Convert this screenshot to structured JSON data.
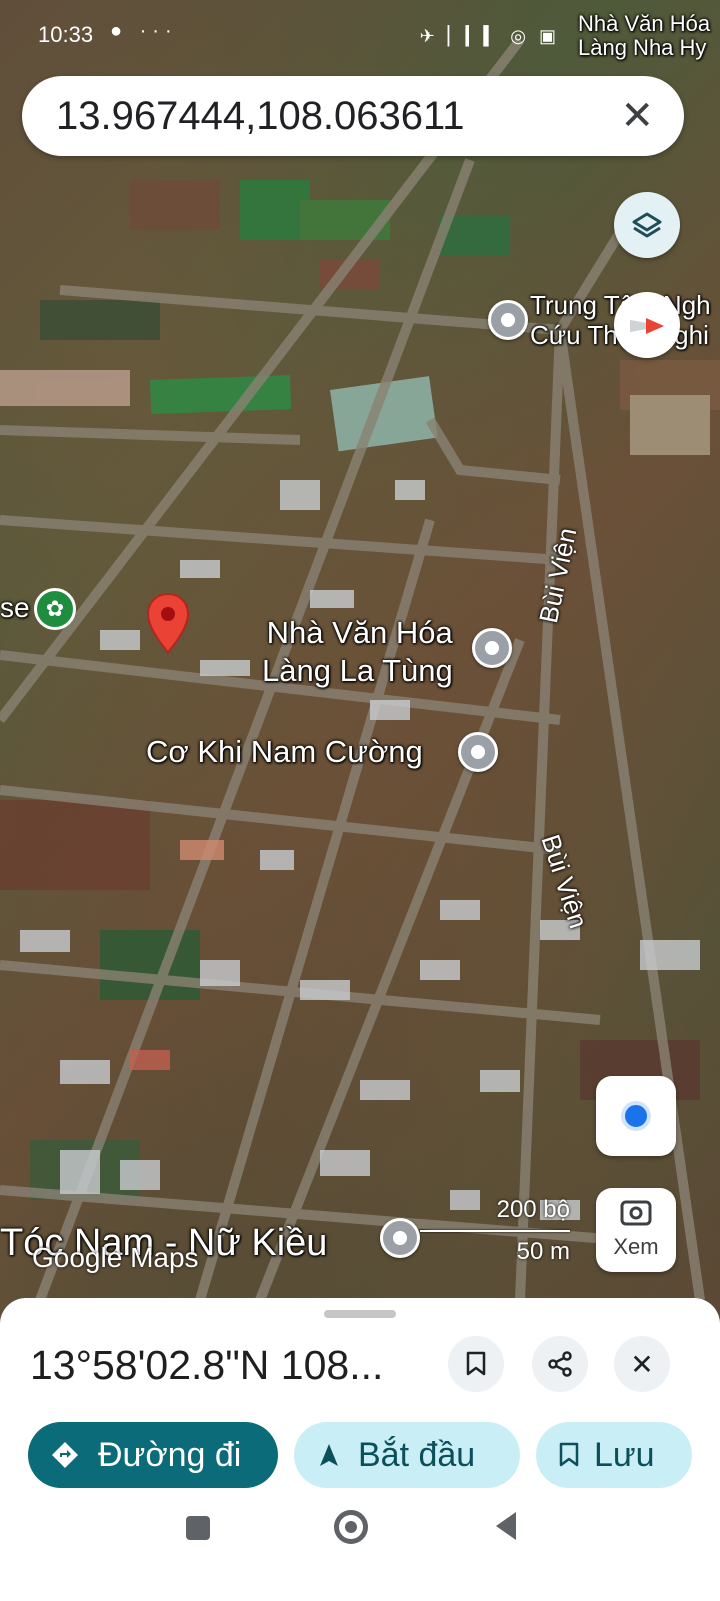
{
  "status_bar": {
    "time": "10:33",
    "left_icons": "● ···",
    "right_icons": "✈ ▏▎▍ ◎ ▣"
  },
  "search": {
    "query": "13.967444,108.063611",
    "clear_icon": "close-icon"
  },
  "map": {
    "places": [
      {
        "name": "Trung Tâm Nghiên Cứu Thực Nghiệm",
        "display": "Trung Tâm Ngh\nCứu Thực Nghi"
      },
      {
        "name": "Nhà Văn Hóa Làng La Tùng",
        "display": "Nhà Văn Hóa\nLàng La Tùng"
      },
      {
        "name": "Cơ Khi Nam Cường",
        "display": "Cơ Khi Nam Cường"
      },
      {
        "name": "Tóc Nam - Nữ Kiều",
        "display": "Tóc Nam - Nữ Kiều"
      },
      {
        "name": "Nhà Văn Hóa Làng Nha Hy",
        "display": "Nhà Văn Hóa\nLàng Nha Hy"
      }
    ],
    "partial_left_label": "se",
    "roads": [
      "Bùi Viện",
      "Bùi Viện"
    ],
    "scale_imperial": "200 bộ",
    "scale_metric": "50 m",
    "watermark": "Google Maps"
  },
  "controls": {
    "layers_icon": "layers-icon",
    "compass_icon": "compass-icon",
    "location_icon": "my-location-icon",
    "lens_label": "Xem"
  },
  "sheet": {
    "coordinate_text": "13°58'02.8\"N 108...",
    "buttons": {
      "directions": "Đường đi",
      "start": "Bắt đầu",
      "save": "Lưu"
    }
  },
  "colors": {
    "directions_bg": "#0b6b78",
    "pill_bg": "#c9eef5",
    "marker": "#ea4335",
    "accent_blue": "#1a73e8"
  }
}
